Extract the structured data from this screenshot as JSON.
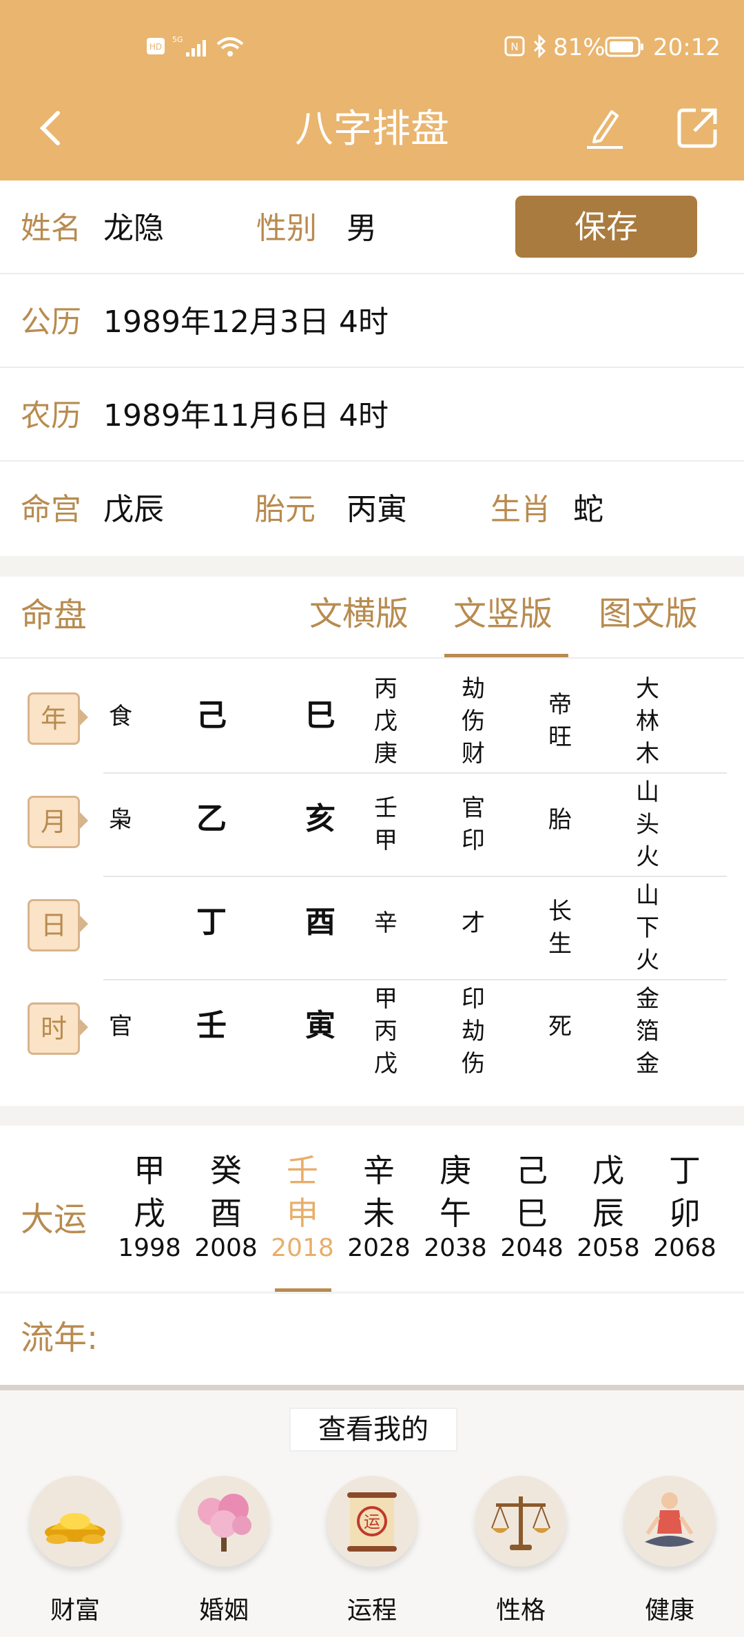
{
  "status_bar": {
    "left": "HD 5G",
    "battery": "81%",
    "time": "20:12"
  },
  "header": {
    "title": "八字排盘",
    "icons": [
      "back-icon",
      "edit-icon",
      "share-icon"
    ]
  },
  "info": {
    "name_label": "姓名",
    "name_value": "龙隐",
    "gender_label": "性别",
    "gender_value": "男",
    "save_label": "保存",
    "solar_label": "公历",
    "solar_value": "1989年12月3日 4时",
    "lunar_label": "农历",
    "lunar_value": "1989年11月6日 4时",
    "minggong_label": "命宫",
    "minggong_value": "戊辰",
    "taiyuan_label": "胎元",
    "taiyuan_value": "丙寅",
    "shengxiao_label": "生肖",
    "shengxiao_value": "蛇"
  },
  "chart": {
    "section_label": "命盘",
    "tabs": [
      {
        "label": "文横版",
        "active": false
      },
      {
        "label": "文竖版",
        "active": true
      },
      {
        "label": "图文版",
        "active": false
      }
    ],
    "rows": [
      {
        "pillar": "年",
        "shishen": "食",
        "gan": "己",
        "zhi": "巳",
        "canggan": "丙\n戊\n庚",
        "canggan_shen": "劫\n伤\n财",
        "changsheng": "帝\n旺",
        "nayin": "大\n林\n木"
      },
      {
        "pillar": "月",
        "shishen": "枭",
        "gan": "乙",
        "zhi": "亥",
        "canggan": "壬\n甲",
        "canggan_shen": "官\n印",
        "changsheng": "胎",
        "nayin": "山\n头\n火"
      },
      {
        "pillar": "日",
        "shishen": "",
        "gan": "丁",
        "zhi": "酉",
        "canggan": "辛",
        "canggan_shen": "才",
        "changsheng": "长\n生",
        "nayin": "山\n下\n火"
      },
      {
        "pillar": "时",
        "shishen": "官",
        "gan": "壬",
        "zhi": "寅",
        "canggan": "甲\n丙\n戊",
        "canggan_shen": "印\n劫\n伤",
        "changsheng": "死",
        "nayin": "金\n箔\n金"
      }
    ]
  },
  "dayun": {
    "label": "大运",
    "items": [
      {
        "gan": "甲",
        "zhi": "戌",
        "year": "1998",
        "active": false
      },
      {
        "gan": "癸",
        "zhi": "酉",
        "year": "2008",
        "active": false
      },
      {
        "gan": "壬",
        "zhi": "申",
        "year": "2018",
        "active": true
      },
      {
        "gan": "辛",
        "zhi": "未",
        "year": "2028",
        "active": false
      },
      {
        "gan": "庚",
        "zhi": "午",
        "year": "2038",
        "active": false
      },
      {
        "gan": "己",
        "zhi": "巳",
        "year": "2048",
        "active": false
      },
      {
        "gan": "戊",
        "zhi": "辰",
        "year": "2058",
        "active": false
      },
      {
        "gan": "丁",
        "zhi": "卯",
        "year": "2068",
        "active": false
      }
    ]
  },
  "liunian": {
    "label": "流年:"
  },
  "bottom": {
    "title": "查看我的",
    "items": [
      {
        "label": "财富",
        "icon": "gold-ingot-icon"
      },
      {
        "label": "婚姻",
        "icon": "blossom-tree-icon"
      },
      {
        "label": "运程",
        "icon": "scroll-yun-icon"
      },
      {
        "label": "性格",
        "icon": "scales-icon"
      },
      {
        "label": "健康",
        "icon": "meditation-icon"
      }
    ]
  },
  "colors": {
    "header_bg": "#e9b56f",
    "label_gold": "#b88b4f",
    "button_brown": "#a97b3f",
    "active_orange": "#e8ae6b"
  }
}
